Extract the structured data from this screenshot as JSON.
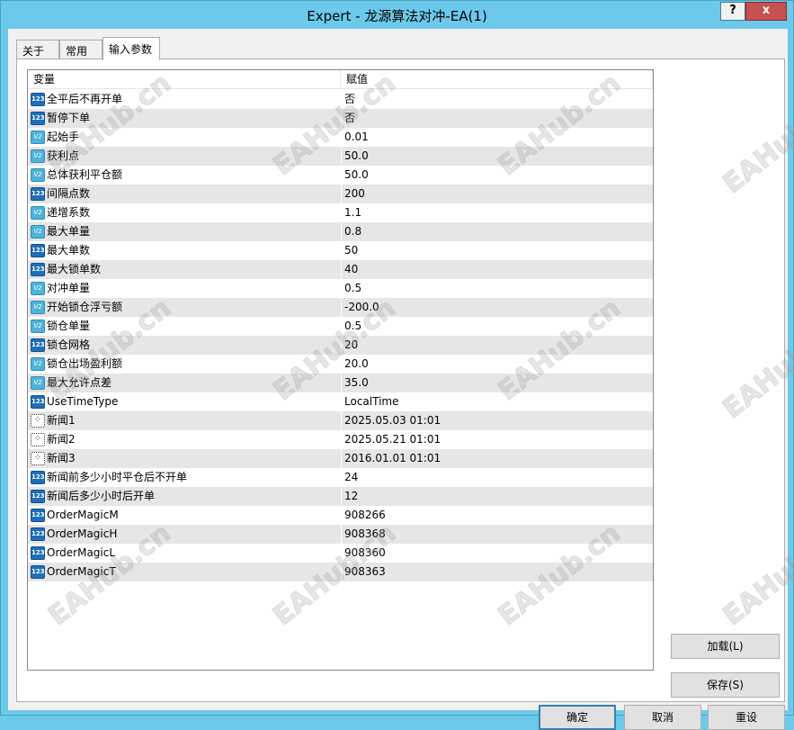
{
  "window": {
    "title": "Expert - 龙源算法对冲-EA(1)",
    "help_label": "?",
    "close_label": "x"
  },
  "tabs": [
    {
      "label": "关于"
    },
    {
      "label": "常用"
    },
    {
      "label": "输入参数"
    }
  ],
  "grid": {
    "headers": {
      "variable": "变量",
      "value": "赋值"
    },
    "rows": [
      {
        "type": "int",
        "name": "全平后不再开单",
        "value": "否"
      },
      {
        "type": "int",
        "name": "暂停下单",
        "value": "否"
      },
      {
        "type": "double",
        "name": "起始手",
        "value": "0.01"
      },
      {
        "type": "double",
        "name": "获利点",
        "value": "50.0"
      },
      {
        "type": "double",
        "name": "总体获利平仓额",
        "value": "50.0"
      },
      {
        "type": "int",
        "name": "间隔点数",
        "value": "200"
      },
      {
        "type": "double",
        "name": "递增系数",
        "value": "1.1"
      },
      {
        "type": "double",
        "name": "最大单量",
        "value": "0.8"
      },
      {
        "type": "int",
        "name": "最大单数",
        "value": "50"
      },
      {
        "type": "int",
        "name": "最大锁单数",
        "value": "40"
      },
      {
        "type": "double",
        "name": "对冲单量",
        "value": "0.5"
      },
      {
        "type": "double",
        "name": "开始锁仓浮亏额",
        "value": "-200.0"
      },
      {
        "type": "double",
        "name": "锁仓单量",
        "value": "0.5"
      },
      {
        "type": "int",
        "name": "锁仓网格",
        "value": "20"
      },
      {
        "type": "double",
        "name": "锁仓出场盈利额",
        "value": "20.0"
      },
      {
        "type": "double",
        "name": "最大允许点差",
        "value": "35.0"
      },
      {
        "type": "int",
        "name": "UseTimeType",
        "value": "LocalTime"
      },
      {
        "type": "datetime",
        "name": "新闻1",
        "value": "2025.05.03 01:01"
      },
      {
        "type": "datetime",
        "name": "新闻2",
        "value": "2025.05.21 01:01"
      },
      {
        "type": "datetime",
        "name": "新闻3",
        "value": "2016.01.01 01:01"
      },
      {
        "type": "int",
        "name": "新闻前多少小时平仓后不开单",
        "value": "24"
      },
      {
        "type": "int",
        "name": "新闻后多少小时后开单",
        "value": "12"
      },
      {
        "type": "int",
        "name": "OrderMagicM",
        "value": "908266"
      },
      {
        "type": "int",
        "name": "OrderMagicH",
        "value": "908368"
      },
      {
        "type": "int",
        "name": "OrderMagicL",
        "value": "908360"
      },
      {
        "type": "int",
        "name": "OrderMagicT",
        "value": "908363"
      }
    ]
  },
  "icons": {
    "int": "123",
    "double": "V2",
    "datetime": "⁘"
  },
  "buttons": {
    "load": "加载(L)",
    "save": "保存(S)",
    "ok": "确定",
    "cancel": "取消",
    "reset": "重设"
  },
  "watermark": "EAHub.cn"
}
